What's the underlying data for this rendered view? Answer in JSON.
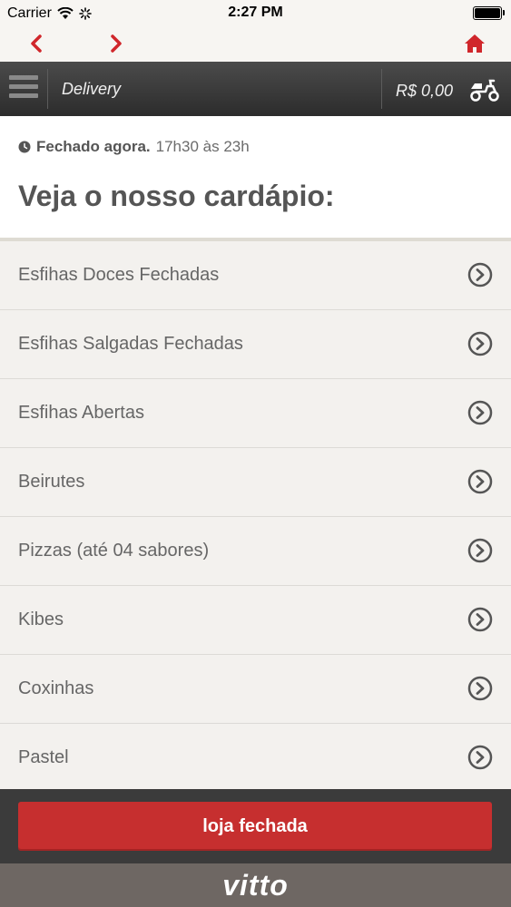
{
  "status_bar": {
    "carrier": "Carrier",
    "time": "2:27 PM"
  },
  "nav": {
    "back_icon": "chevron-left-icon",
    "forward_icon": "chevron-right-icon",
    "home_icon": "home-icon",
    "accent": "#d0262b"
  },
  "header": {
    "title": "Delivery",
    "cart_total": "R$ 0,00",
    "delivery_icon": "scooter-icon"
  },
  "store": {
    "status": "Fechado agora.",
    "hours": "17h30 às 23h",
    "menu_heading": "Veja o nosso cardápio:"
  },
  "menu": {
    "items": [
      {
        "label": "Esfihas Doces Fechadas"
      },
      {
        "label": "Esfihas Salgadas Fechadas"
      },
      {
        "label": "Esfihas Abertas"
      },
      {
        "label": "Beirutes"
      },
      {
        "label": "Pizzas (até 04 sabores)"
      },
      {
        "label": "Kibes"
      },
      {
        "label": "Coxinhas"
      },
      {
        "label": "Pastel"
      }
    ]
  },
  "action": {
    "label": "loja fechada",
    "color": "#c62f2f"
  },
  "footer": {
    "brand": "vitto"
  }
}
